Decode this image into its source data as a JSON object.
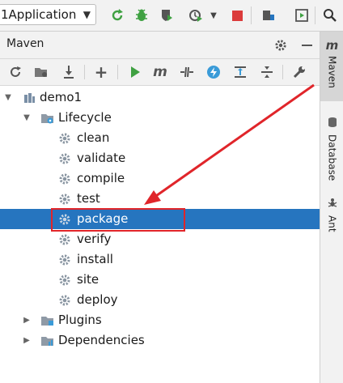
{
  "toolbar": {
    "run_config": "1Application",
    "icons": [
      "refresh-run-icon",
      "debug-bug-icon",
      "coverage-shield-icon",
      "profile-run-icon",
      "stop-icon",
      "project-structure-icon",
      "run-panel-icon",
      "search-icon"
    ]
  },
  "tool_window": {
    "title": "Maven"
  },
  "tree": {
    "project": "demo1",
    "lifecycle": "Lifecycle",
    "goals": [
      "clean",
      "validate",
      "compile",
      "test",
      "package",
      "verify",
      "install",
      "site",
      "deploy"
    ],
    "plugins": "Plugins",
    "dependencies": "Dependencies",
    "selected_goal": "package"
  },
  "stripe": {
    "maven": "Maven",
    "database": "Database",
    "ant": "Ant"
  },
  "colors": {
    "selection": "#2675bf",
    "annotation": "#e0252a",
    "run_green": "#3fa142",
    "stop_red": "#db3b3b"
  }
}
